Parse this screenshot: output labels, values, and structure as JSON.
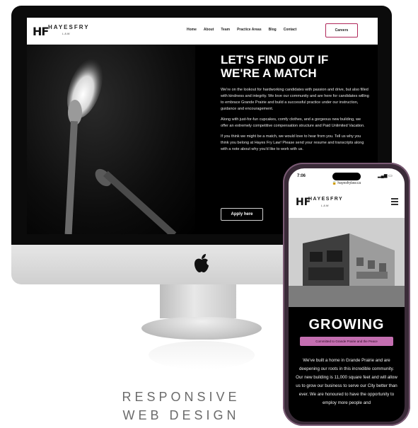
{
  "desktop_site": {
    "logo": {
      "mark": "HF",
      "name": "HAYESFRY",
      "sub": "LAW"
    },
    "nav": [
      "Home",
      "About",
      "Team",
      "Practice Areas",
      "Blog",
      "Contact"
    ],
    "cta_label": "Careers",
    "hero_title": "LET'S FIND OUT IF WE'RE A MATCH",
    "paragraphs": [
      "We're on the lookout for hardworking candidates with passion and drive, but also filled with kindness and integrity. We love our community and are here for candidates willing to embrace Grande Prairie and build a successful practice under our instruction, guidance and encouragement.",
      "Along with just-for-fun cupcakes, comfy clothes, and a gorgeous new building, we offer an extremely competitive compensation structure and Paid Unlimited Vacation.",
      "If you think we might be a match, we would love to hear from you. Tell us why you think you belong at Hayes Fry Law! Please send your resume and transcripts along with a note about why you'd like to work with us."
    ],
    "apply_label": "Apply here"
  },
  "mobile_site": {
    "status_time": "7:06",
    "url": "hayesfrylaw.ca",
    "logo": {
      "mark": "HF",
      "name": "HAYESFRY",
      "sub": "LAW"
    },
    "heading": "GROWING",
    "pill_text": "Committed to Grande Prairie and the Peace",
    "body": "We've built a home in Grande Prairie and are deepening our roots in this incredible community. Our new building is 11,000 square feet and will allow us to grow our business to serve our City better than ever. We are honoured to have the opportunity to employ more people and"
  },
  "tagline": {
    "line1": "RESPONSIVE",
    "line2": "WEB DESIGN"
  },
  "colors": {
    "accent": "#b0275a",
    "pill": "#c46fb1",
    "phone_frame": "#3a2b38"
  }
}
